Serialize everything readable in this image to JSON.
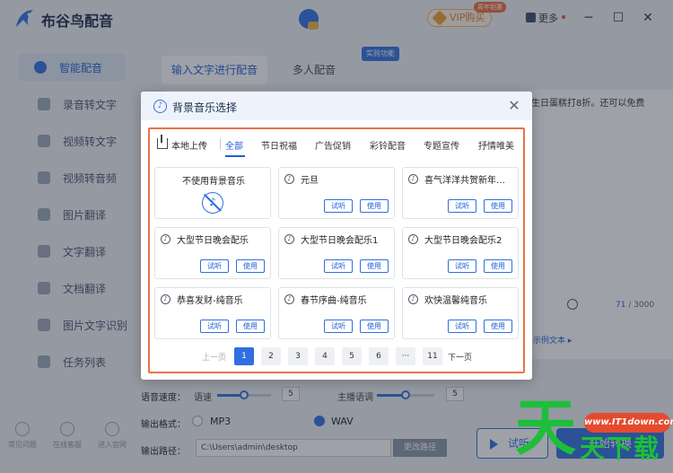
{
  "app": {
    "title": "布谷鸟配音",
    "vip_label": "VIP购买",
    "vip_badge": "周年钜惠",
    "more_label": "更多",
    "minimize": "─",
    "maximize": "☐",
    "close": "✕",
    "brand_color": "#2f6fe0"
  },
  "sidebar": {
    "items": [
      {
        "label": "智能配音",
        "icon": "mic-icon",
        "active": true
      },
      {
        "label": "录音转文字",
        "icon": "ai-text-icon"
      },
      {
        "label": "视频转文字",
        "icon": "video-icon"
      },
      {
        "label": "视频转音频",
        "icon": "video-audio-icon"
      },
      {
        "label": "图片翻译",
        "icon": "image-icon"
      },
      {
        "label": "文字翻译",
        "icon": "translate-icon"
      },
      {
        "label": "文档翻译",
        "icon": "document-icon"
      },
      {
        "label": "图片文字识别",
        "icon": "ocr-icon"
      },
      {
        "label": "任务列表",
        "icon": "list-icon"
      }
    ],
    "bottom": [
      {
        "label": "常见问题",
        "icon": "question-icon"
      },
      {
        "label": "在线客服",
        "icon": "support-icon"
      },
      {
        "label": "进入官网",
        "icon": "website-icon"
      }
    ]
  },
  "main": {
    "tab_text_input": "输入文字进行配音",
    "tab_multi": "多人配音",
    "lab_badge": "实验功能",
    "editor_text": "生日蛋糕打8折。还可以免费",
    "counter_current": "71",
    "counter_total": " / 3000",
    "sample_text": "示例文本 ▸",
    "speed_label": "语音速度：",
    "speed_sub": "语速",
    "speed_value": "5",
    "pitch_sub": "主播语调",
    "pitch_value": "5",
    "speed_level": 0.5,
    "pitch_level": 0.5,
    "format_label": "输出格式：",
    "format_mp3": "MP3",
    "format_wav": "WAV",
    "path_label": "输出路径：",
    "path_value": "C:\\Users\\admin\\desktop",
    "change_path": "更改路径",
    "listen_button": "试听",
    "start_button": "开始转换"
  },
  "dialog": {
    "title": "背景音乐选择",
    "upload_label": "本地上传",
    "categories": [
      {
        "label": "全部",
        "active": true
      },
      {
        "label": "节日祝福"
      },
      {
        "label": "广告促销"
      },
      {
        "label": "彩铃配音"
      },
      {
        "label": "专题宣传"
      },
      {
        "label": "抒情唯美"
      }
    ],
    "listen_label": "试听",
    "use_label": "使用",
    "no_music_label": "不使用背景音乐",
    "tracks": [
      "元旦",
      "喜气洋洋共贺新年…",
      "大型节日晚会配乐",
      "大型节日晚会配乐1",
      "大型节日晚会配乐2",
      "恭喜发财-纯音乐",
      "春节序曲-纯音乐",
      "欢快温馨纯音乐"
    ],
    "pager": {
      "prev": "上一页",
      "next": "下一页",
      "pages": [
        "1",
        "2",
        "3",
        "4",
        "5",
        "6",
        "···",
        "11"
      ],
      "current": "1"
    },
    "accent_color": "#e8734a"
  },
  "watermark": {
    "big_text": "天",
    "url_text": "www.IT1down.com",
    "small_text": "天下载"
  }
}
